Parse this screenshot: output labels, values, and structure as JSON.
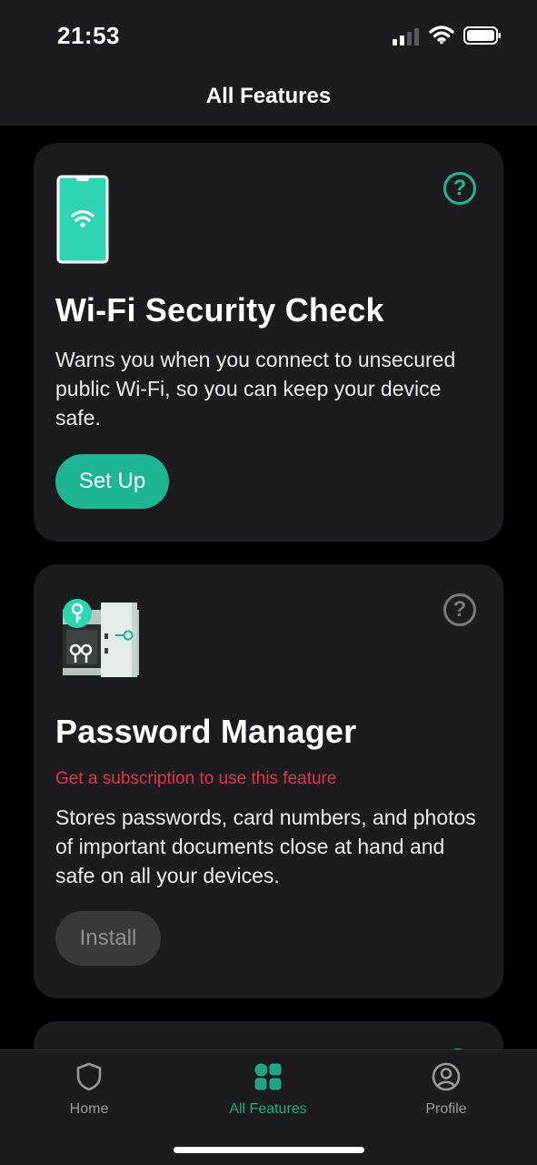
{
  "status": {
    "time": "21:53"
  },
  "nav": {
    "title": "All Features"
  },
  "cards": [
    {
      "title": "Wi-Fi Security Check",
      "description": "Warns you when you connect to unsecured public Wi-Fi, so you can keep your device safe.",
      "button": "Set Up",
      "help_icon": "question-circle-icon",
      "illustration": "phone-wifi-icon",
      "accent": "#1db592"
    },
    {
      "title": "Password Manager",
      "warning": "Get a subscription to use this feature",
      "description": "Stores passwords, card numbers, and photos of important documents close at hand and safe on all your devices.",
      "button": "Install",
      "help_icon": "question-circle-icon",
      "illustration": "safe-keys-icon",
      "warning_color": "#e3334a"
    }
  ],
  "tabs": [
    {
      "label": "Home",
      "icon": "shield-icon",
      "active": false
    },
    {
      "label": "All Features",
      "icon": "grid-icon",
      "active": true
    },
    {
      "label": "Profile",
      "icon": "user-circle-icon",
      "active": false
    }
  ],
  "colors": {
    "accent": "#1db592",
    "background": "#000000",
    "card": "#1c1c1e"
  }
}
